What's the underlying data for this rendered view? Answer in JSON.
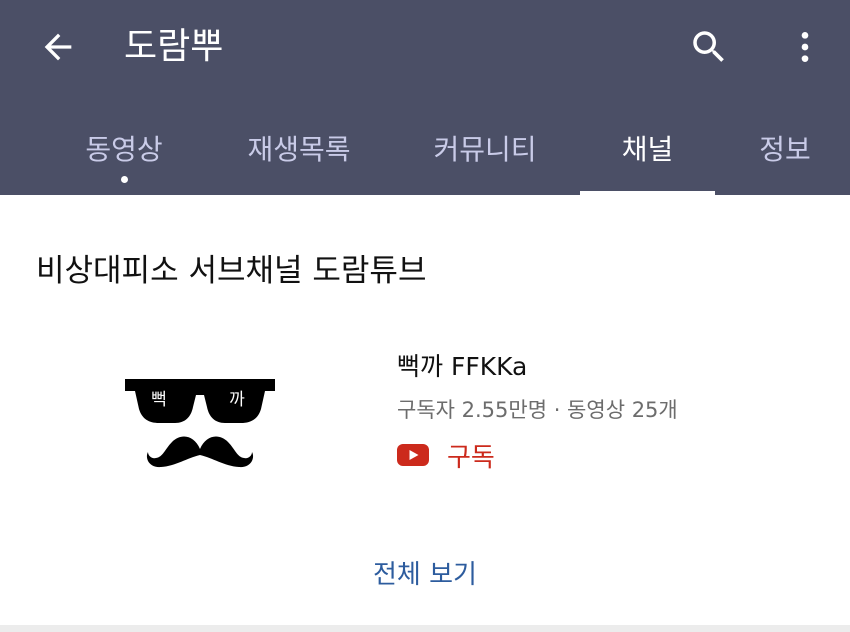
{
  "header": {
    "title": "도람뿌",
    "back_icon": "arrow-left-icon",
    "search_icon": "search-icon",
    "more_icon": "more-vert-icon",
    "background_color": "#4b4f66"
  },
  "tabs": [
    {
      "label": "동영상",
      "has_dot": true,
      "active": false
    },
    {
      "label": "재생목록",
      "has_dot": false,
      "active": false
    },
    {
      "label": "커뮤니티",
      "has_dot": false,
      "active": false
    },
    {
      "label": "채널",
      "has_dot": false,
      "active": true
    },
    {
      "label": "정보",
      "has_dot": false,
      "active": false
    }
  ],
  "section": {
    "title": "비상대피소 서브채널 도람튜브",
    "channel": {
      "avatar_text_left": "뻑",
      "avatar_text_right": "까",
      "name": "뻑까 FFKKa",
      "meta": "구독자 2.55만명 · 동영상 25개",
      "subscribe_icon": "youtube-icon",
      "subscribe_label": "구독",
      "subscribe_color": "#cc2a1c"
    },
    "view_all_label": "전체 보기"
  }
}
